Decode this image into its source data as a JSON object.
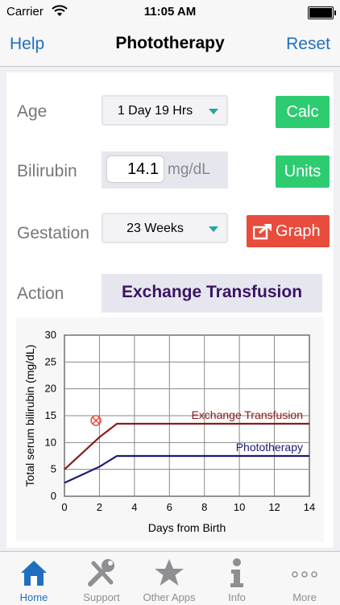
{
  "status_bar": {
    "carrier": "Carrier",
    "time": "11:05 AM"
  },
  "nav": {
    "help_label": "Help",
    "title": "Phototherapy",
    "reset_label": "Reset"
  },
  "form": {
    "age_label": "Age",
    "age_value": "1 Day 19 Hrs",
    "calc_label": "Calc",
    "bilirubin_label": "Bilirubin",
    "bilirubin_value": "14.1",
    "bilirubin_unit": "mg/dL",
    "units_label": "Units",
    "gestation_label": "Gestation",
    "gestation_value": "23 Weeks",
    "graph_label": "Graph",
    "action_label": "Action",
    "action_value": "Exchange Transfusion"
  },
  "colors": {
    "accent": "#1f6fbf",
    "green": "#2ecc71",
    "red": "#e74c3c",
    "exchange_line": "#8b1a1a",
    "photo_line": "#1a1a7a",
    "action_text": "#3b1464"
  },
  "chart_data": {
    "type": "line",
    "xlabel": "Days from Birth",
    "ylabel": "Total serum bilirubin (mg/dL)",
    "xlim": [
      0,
      14
    ],
    "ylim": [
      0,
      30
    ],
    "xticks": [
      0,
      2,
      4,
      6,
      8,
      10,
      12,
      14
    ],
    "yticks": [
      0,
      5,
      10,
      15,
      20,
      25,
      30
    ],
    "grid": true,
    "series": [
      {
        "name": "Exchange Transfusion",
        "color": "#8b1a1a",
        "x": [
          0,
          1,
          1.5,
          2,
          3,
          14
        ],
        "y": [
          5,
          8,
          9.5,
          11,
          13.5,
          13.5
        ]
      },
      {
        "name": "Phototherapy",
        "color": "#1a1a7a",
        "x": [
          0,
          1,
          2,
          3,
          14
        ],
        "y": [
          2.5,
          4,
          5.5,
          7.5,
          7.5
        ]
      }
    ],
    "patient_point": {
      "x": 1.8,
      "y": 14.1,
      "color": "#e74c3c"
    }
  },
  "tabs": [
    {
      "label": "Home",
      "icon": "home-icon",
      "active": true
    },
    {
      "label": "Support",
      "icon": "tools-icon",
      "active": false
    },
    {
      "label": "Other Apps",
      "icon": "star-icon",
      "active": false
    },
    {
      "label": "Info",
      "icon": "info-icon",
      "active": false
    },
    {
      "label": "More",
      "icon": "more-icon",
      "active": false
    }
  ]
}
